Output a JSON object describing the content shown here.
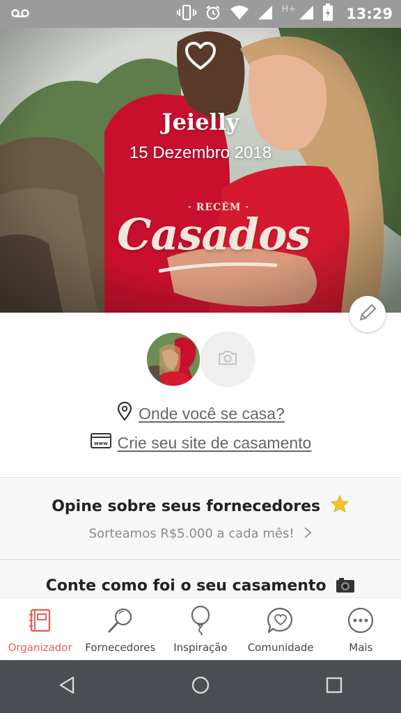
{
  "status_bar": {
    "time": "13:29",
    "network_type": "H+",
    "icons": [
      "voicemail-icon",
      "vibrate-icon",
      "alarm-icon",
      "wifi-icon",
      "signal-icon",
      "battery-icon"
    ]
  },
  "hero": {
    "couple_name": "Jeielly",
    "wedding_date": "15 Dezembro 2018",
    "logo_small": "· RECÉM ·",
    "logo_main": "Casados",
    "icons": [
      "heart-icon",
      "pencil-icon"
    ]
  },
  "profile": {
    "location_link": "Onde você se casa?",
    "website_link": "Crie seu site de casamento",
    "icons": [
      "location-pin-icon",
      "browser-www-icon",
      "camera-icon"
    ]
  },
  "cards": {
    "review": {
      "title": "Opine sobre seus fornecedores",
      "subtitle": "Sorteamos R$5.000 a cada mês!",
      "icons": [
        "star-icon",
        "chevron-right-icon"
      ]
    },
    "story": {
      "title": "Conte como foi o seu casamento",
      "icons": [
        "camera-emoji-icon"
      ]
    }
  },
  "bottom_nav": {
    "items": [
      {
        "label": "Organizador",
        "icon": "planner-book-icon",
        "active": true
      },
      {
        "label": "Fornecedores",
        "icon": "magnifier-icon",
        "active": false
      },
      {
        "label": "Inspiração",
        "icon": "balloon-icon",
        "active": false
      },
      {
        "label": "Comunidade",
        "icon": "chat-heart-icon",
        "active": false
      },
      {
        "label": "Mais",
        "icon": "more-dots-icon",
        "active": false
      }
    ]
  },
  "system_nav": {
    "icons": [
      "back-triangle-icon",
      "home-circle-icon",
      "recents-square-icon"
    ]
  },
  "colors": {
    "accent": "#e2625d",
    "status_bar": "#9b9b9b",
    "system_nav": "#4a4d52",
    "card_background": "#f7f7f7",
    "logo_cream": "#f3e6da"
  }
}
